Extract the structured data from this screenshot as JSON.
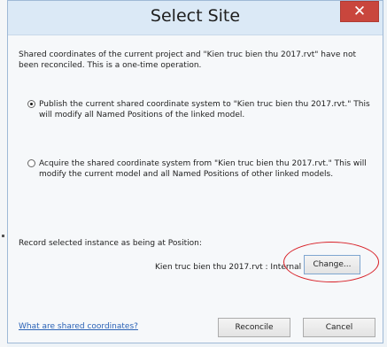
{
  "dialog": {
    "title": "Select Site",
    "close_glyph": "✕",
    "description": "Shared coordinates of the current project and \"Kien truc bien thu 2017.rvt\" have not been reconciled. This is a one-time operation.",
    "options": [
      {
        "label": "Publish the current shared coordinate system to \"Kien truc bien thu 2017.rvt.\" This will modify all Named Positions of the linked model.",
        "selected": true
      },
      {
        "label": "Acquire the shared coordinate system from \"Kien truc bien thu 2017.rvt.\" This will modify the current model and all Named Positions of other linked models.",
        "selected": false
      }
    ],
    "record_label": "Record selected instance as being at Position:",
    "instance_position": "Kien truc bien thu 2017.rvt : Internal",
    "change_button": "Change...",
    "help_link": "What are shared coordinates?",
    "reconcile_button": "Reconcile",
    "cancel_button": "Cancel"
  },
  "colors": {
    "titlebar": "#dbe9f6",
    "close_button": "#c9463d",
    "link": "#2a62b6",
    "annotation": "#d81f26"
  },
  "icons": [
    "close-icon",
    "radio-selected-icon",
    "radio-unselected-icon"
  ]
}
